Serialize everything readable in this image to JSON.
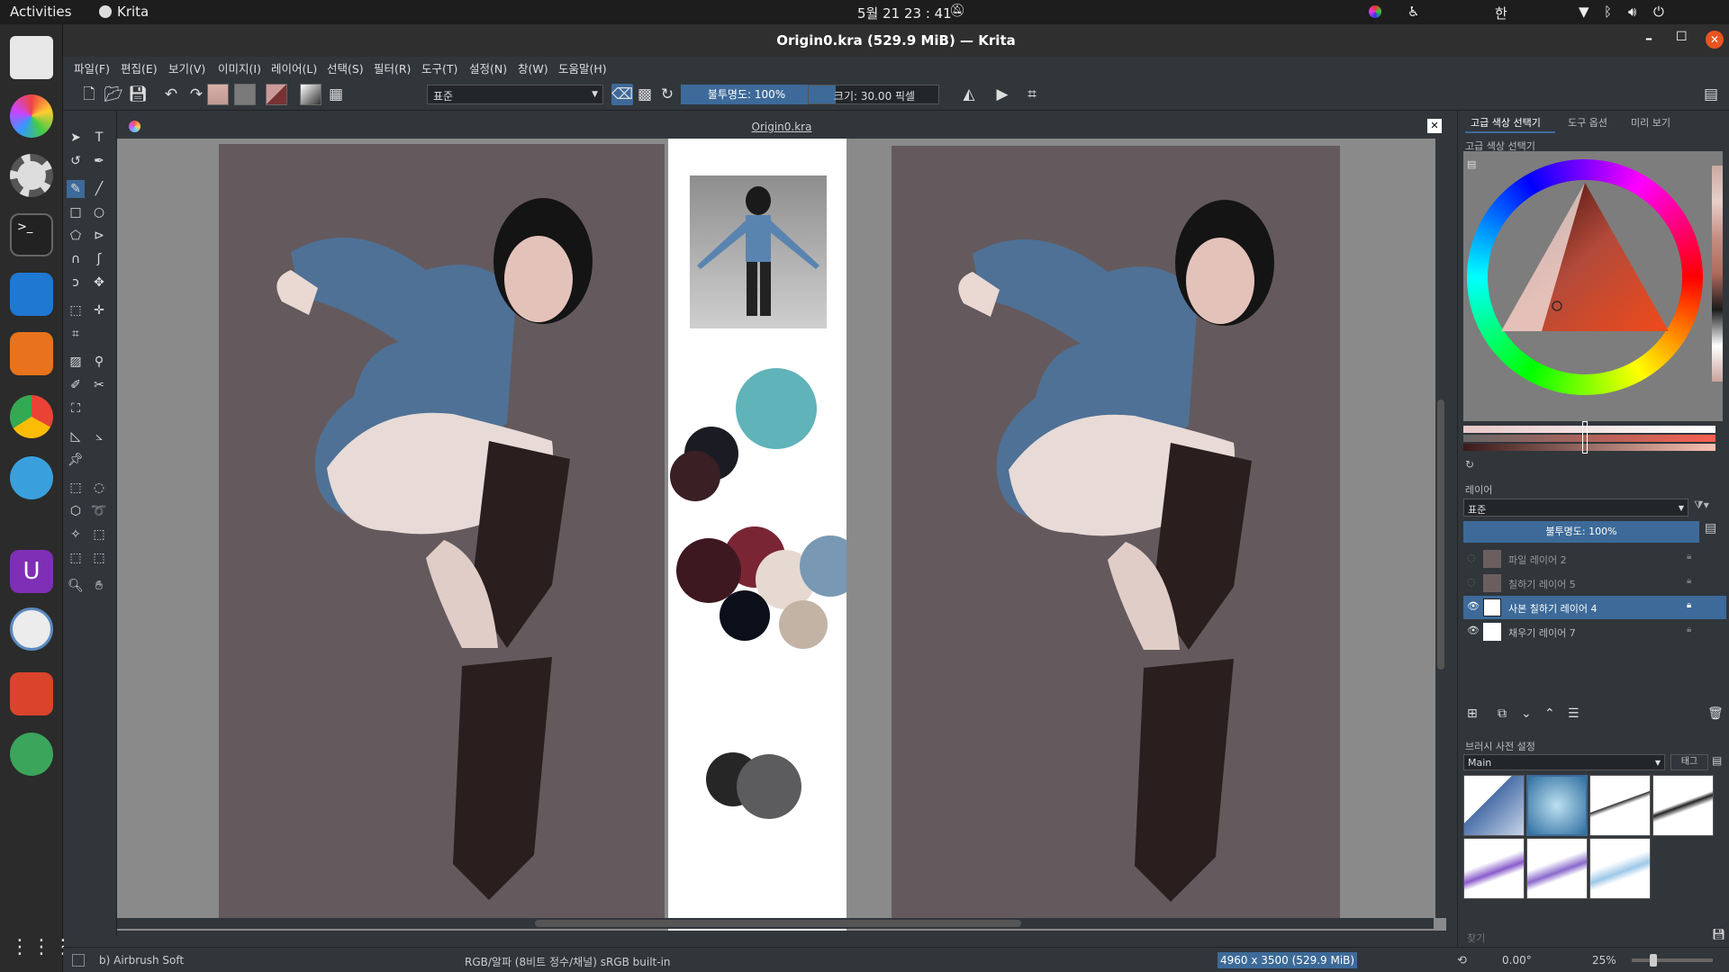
{
  "topbar": {
    "activities": "Activities",
    "app_name": "Krita",
    "clock": "5월 21  23 : 41",
    "input_method": "한"
  },
  "window": {
    "title": "Origin0.kra (529.9 MiB) — Krita"
  },
  "menu": [
    "파일(F)",
    "편집(E)",
    "보기(V)",
    "이미지(I)",
    "레이어(L)",
    "선택(S)",
    "필터(R)",
    "도구(T)",
    "설정(N)",
    "창(W)",
    "도움말(H)"
  ],
  "toolbar": {
    "blend_mode": "표준",
    "opacity_label": "불투명도: 100%",
    "size_label": "크기: 30.00 픽셀"
  },
  "document": {
    "tab_title": "Origin0.kra"
  },
  "dockers": {
    "tabs": [
      "고급 색상 선택기",
      "도구 옵션",
      "미리 보기"
    ],
    "color_selector_title": "고급 색상 선택기",
    "layers_title": "레이어",
    "layers_blend": "표준",
    "layers_opacity": "불투명도: 100%",
    "layers": [
      {
        "name": "파일 레이어 2",
        "visible": false,
        "active": false
      },
      {
        "name": "칠하기 레이어 5",
        "visible": false,
        "active": false
      },
      {
        "name": "사본 칠하기 레이어 4",
        "visible": true,
        "active": true
      },
      {
        "name": "채우기 레이어 7",
        "visible": true,
        "active": false
      }
    ],
    "brush_presets_title": "브러시 사전 설정",
    "brush_tag": "Main",
    "tag_button": "태그",
    "search_placeholder": "찾기"
  },
  "status": {
    "brush": "b) Airbrush Soft",
    "color_space": "RGB/알파 (8비트 정수/채널)  sRGB built-in",
    "image_size": "4960 x 3500 (529.9 MiB)",
    "rotation": "0.00°",
    "zoom": "25%"
  },
  "colors": {
    "accent": "#3d6a99",
    "panel_bg": "#31363b",
    "canvas_bg": "#8a8a8a",
    "palette_swatches": [
      "#1b1c23",
      "#3a1f24",
      "#5fb3b9",
      "#7a2534",
      "#3e1820",
      "#e6d9d2",
      "#7898b4",
      "#0b0f19",
      "#c3b3a4",
      "#262626",
      "#5c5c5e"
    ]
  }
}
